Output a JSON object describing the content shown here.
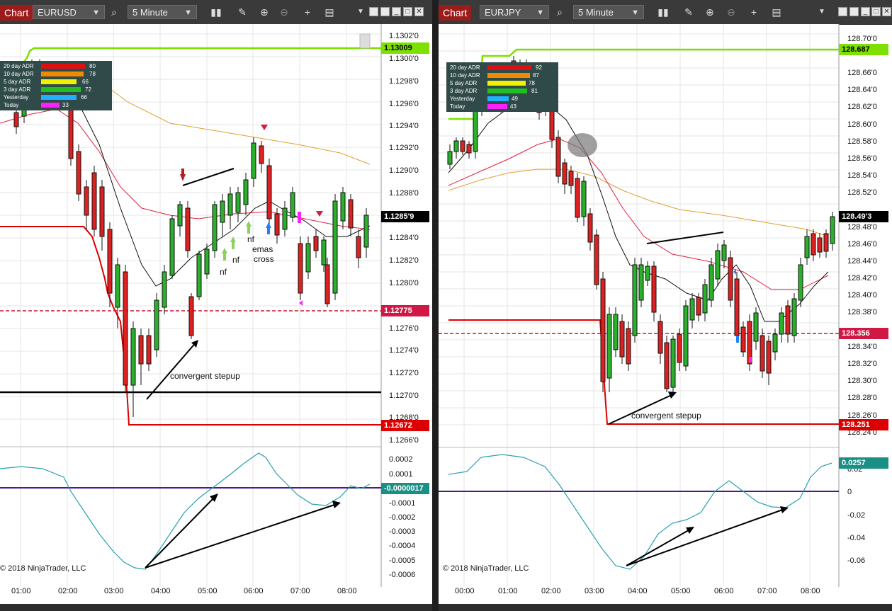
{
  "left": {
    "tab": "Chart",
    "instrument": "EURUSD",
    "interval": "5 Minute",
    "price_ticks": [
      "1.1302'0",
      "1.1300'0",
      "1.1298'0",
      "1.1296'0",
      "1.1294'0",
      "1.1292'0",
      "1.1290'0",
      "1.1288'0",
      "1.1284'0",
      "1.1282'0",
      "1.1280'0",
      "1.1276'0",
      "1.1274'0",
      "1.1272'0",
      "1.1270'0",
      "1.1268'0",
      "1.1266'0"
    ],
    "box_top": "1.13009",
    "box_current": "1.1285'9",
    "box_red": "1.12775",
    "box_low": "1.12672",
    "adr": [
      {
        "label": "20 day ADR",
        "value": "80",
        "color": "#e01010"
      },
      {
        "label": "10 day ADR",
        "value": "78",
        "color": "#f08a00"
      },
      {
        "label": "5 day ADR",
        "value": "66",
        "color": "#f0f000"
      },
      {
        "label": "3 day ADR",
        "value": "72",
        "color": "#20c020"
      },
      {
        "label": "Yesterday",
        "value": "66",
        "color": "#20b0ff"
      },
      {
        "label": "Today",
        "value": "33",
        "color": "#ff20ff"
      }
    ],
    "annotations": {
      "stepup": "convergent stepup",
      "nf1": "nf",
      "nf2": "nf",
      "nf3": "nf",
      "emas": "emas",
      "cross": "cross"
    },
    "osc_ticks": [
      "0.0002",
      "0.0001",
      "-0.0001",
      "-0.0002",
      "-0.0003",
      "-0.0004",
      "-0.0005",
      "-0.0006"
    ],
    "osc_value": "-0.0000017",
    "copyright": "© 2018 NinjaTrader, LLC",
    "times": [
      "01:00",
      "02:00",
      "03:00",
      "04:00",
      "05:00",
      "06:00",
      "07:00",
      "08:00"
    ]
  },
  "right": {
    "tab": "Chart",
    "instrument": "EURJPY",
    "interval": "5 Minute",
    "price_ticks": [
      "128.70'0",
      "128.66'0",
      "128.64'0",
      "128.62'0",
      "128.60'0",
      "128.58'0",
      "128.56'0",
      "128.54'0",
      "128.52'0",
      "128.48'0",
      "128.46'0",
      "128.44'0",
      "128.42'0",
      "128.40'0",
      "128.38'0",
      "128.34'0",
      "128.32'0",
      "128.30'0",
      "128.28'0",
      "128.26'0",
      "128.24'0"
    ],
    "box_top": "128.687",
    "box_current": "128.49'3",
    "box_red": "128.356",
    "box_low": "128.251",
    "adr": [
      {
        "label": "20 day ADR",
        "value": "92",
        "color": "#e01010"
      },
      {
        "label": "10 day ADR",
        "value": "87",
        "color": "#f08a00"
      },
      {
        "label": "5 day ADR",
        "value": "78",
        "color": "#f0f000"
      },
      {
        "label": "3 day ADR",
        "value": "81",
        "color": "#20c020"
      },
      {
        "label": "Yesterday",
        "value": "49",
        "color": "#20b0ff"
      },
      {
        "label": "Today",
        "value": "43",
        "color": "#ff20ff"
      }
    ],
    "annotations": {
      "stepup": "convergent stepup"
    },
    "osc_ticks": [
      "0.02",
      "0",
      "-0.02",
      "-0.04",
      "-0.06"
    ],
    "osc_value": "0.0257",
    "copyright": "© 2018 NinjaTrader, LLC",
    "times": [
      "00:00",
      "01:00",
      "02:00",
      "03:00",
      "04:00",
      "05:00",
      "06:00",
      "07:00",
      "08:00"
    ]
  }
}
